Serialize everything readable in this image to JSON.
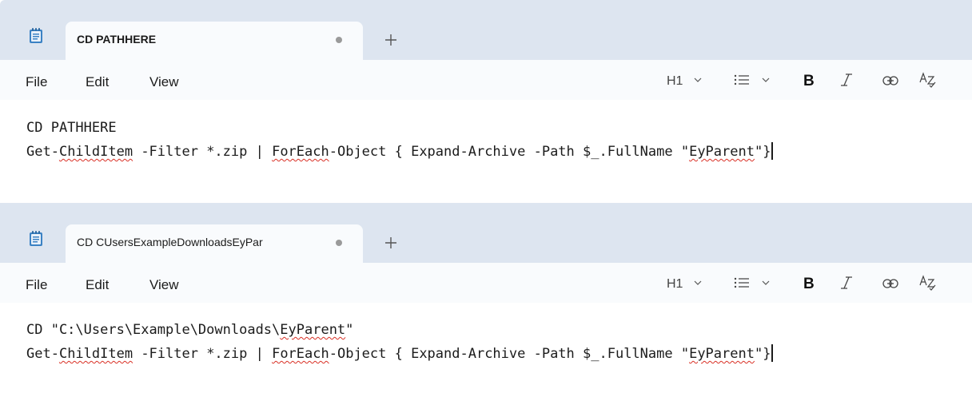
{
  "windows": [
    {
      "tab": {
        "title": "CD PATHHERE"
      },
      "menu": {
        "file": "File",
        "edit": "Edit",
        "view": "View"
      },
      "toolbar": {
        "heading": "H1",
        "bold": "B",
        "italic": "I"
      },
      "editor": {
        "line1": "CD PATHHERE",
        "line2": {
          "p1": "Get-",
          "p2": "ChildItem",
          "p3": " -Filter *.zip | ",
          "p4": "ForEach",
          "p5": "-Object { Expand-Archive -Path $_.FullName \"",
          "p6": "EyParent",
          "p7": "\"}"
        }
      }
    },
    {
      "tab": {
        "title": "CD CUsersExampleDownloadsEyPar"
      },
      "menu": {
        "file": "File",
        "edit": "Edit",
        "view": "View"
      },
      "toolbar": {
        "heading": "H1",
        "bold": "B",
        "italic": "I"
      },
      "editor": {
        "line1": {
          "p1": "CD \"C:\\Users\\Example\\Downloads\\",
          "p2": "EyParent",
          "p3": "\""
        },
        "line2": {
          "p1": "Get-",
          "p2": "ChildItem",
          "p3": " -Filter *.zip | ",
          "p4": "ForEach",
          "p5": "-Object { Expand-Archive -Path $_.FullName \"",
          "p6": "EyParent",
          "p7": "\"}"
        }
      }
    }
  ],
  "icons": {
    "app": "notepad-icon",
    "new_tab": "plus-icon",
    "unsaved": "unsaved-dot-icon",
    "chevron": "chevron-down-icon",
    "list": "bulleted-list-icon",
    "link": "link-icon",
    "spell": "spellcheck-icon"
  },
  "colors": {
    "tabbar_bg": "#dde5f0",
    "active_tab_bg": "#f9fbfd",
    "spellcheck_underline": "#d93025"
  }
}
